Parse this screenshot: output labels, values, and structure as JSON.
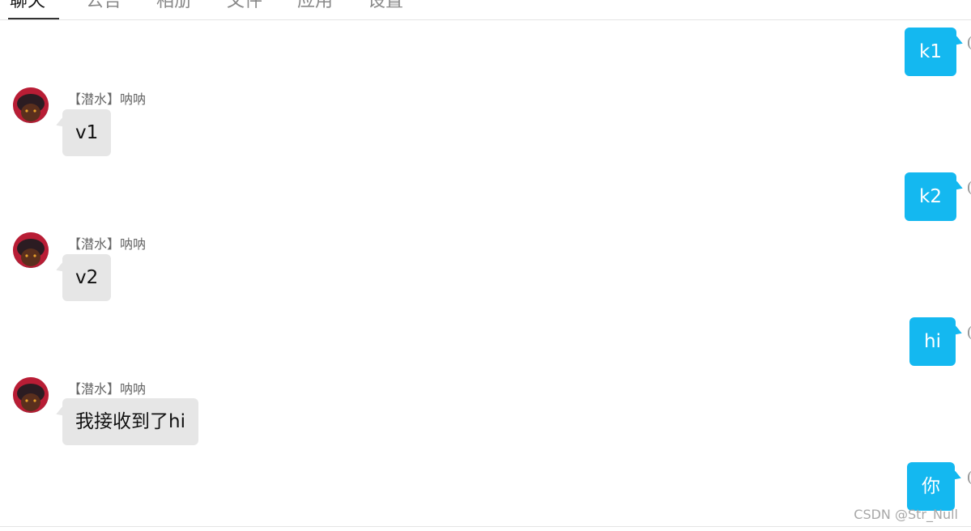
{
  "tabs": [
    {
      "label": "聊天",
      "active": true
    },
    {
      "label": "公告",
      "active": false
    },
    {
      "label": "相册",
      "active": false
    },
    {
      "label": "文件",
      "active": false
    },
    {
      "label": "应用",
      "active": false
    },
    {
      "label": "设置",
      "active": false
    }
  ],
  "messages": [
    {
      "side": "sent",
      "text": "k1"
    },
    {
      "side": "received",
      "sender": "【潜水】呐呐",
      "text": "v1",
      "avatar": "user-avatar"
    },
    {
      "side": "sent",
      "text": "k2"
    },
    {
      "side": "received",
      "sender": "【潜水】呐呐",
      "text": "v2",
      "avatar": "user-avatar"
    },
    {
      "side": "sent",
      "text": "hi"
    },
    {
      "side": "received",
      "sender": "【潜水】呐呐",
      "text": "我接收到了hi",
      "avatar": "user-avatar"
    },
    {
      "side": "sent",
      "text": "你"
    }
  ],
  "watermark": "CSDN @Str_Null",
  "colors": {
    "sent_bubble": "#14b8f0",
    "received_bubble": "#e6e6e6",
    "divider": "#e4e4e4"
  }
}
